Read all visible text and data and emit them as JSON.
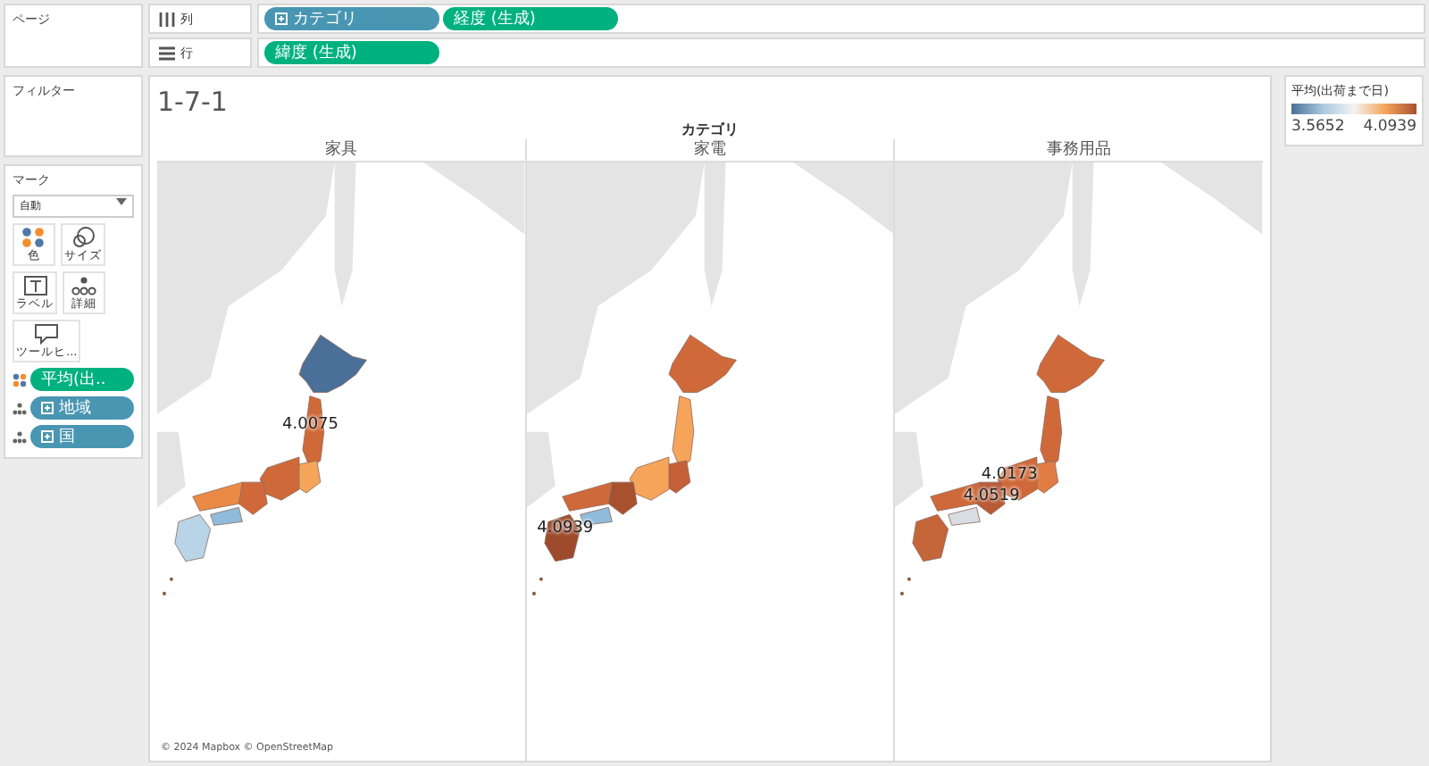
{
  "pages": {
    "title": "ページ"
  },
  "filters": {
    "title": "フィルター"
  },
  "marks": {
    "title": "マーク",
    "mark_type": "自動",
    "buttons": [
      {
        "kind": "color",
        "label": "色"
      },
      {
        "kind": "size",
        "label": "サイズ"
      },
      {
        "kind": "label",
        "label": "ラベル"
      },
      {
        "kind": "detail",
        "label": "詳細"
      },
      {
        "kind": "tooltip",
        "label": "ツールヒ..."
      }
    ],
    "pills": [
      {
        "kind": "color",
        "label": "平均(出..",
        "discrete": false
      },
      {
        "kind": "detail",
        "label": "地域",
        "discrete": true
      },
      {
        "kind": "detail",
        "label": "国",
        "discrete": true
      }
    ]
  },
  "shelves": [
    {
      "kind": "columns",
      "label": "列",
      "pills": [
        {
          "label": "カテゴリ",
          "discrete": true
        },
        {
          "label": "経度 (生成)",
          "discrete": false
        }
      ]
    },
    {
      "kind": "rows",
      "label": "行",
      "pills": [
        {
          "label": "緯度 (生成)",
          "discrete": false
        }
      ]
    }
  ],
  "view": {
    "title": "1-7-1",
    "header": "カテゴリ",
    "panels": [
      {
        "name": "家具",
        "labels": [
          "4.0075"
        ]
      },
      {
        "name": "家電",
        "labels": [
          "4.0939"
        ]
      },
      {
        "name": "事務用品",
        "labels": [
          "4.0173",
          "4.0519"
        ]
      }
    ],
    "attribution": "© 2024 Mapbox © OpenStreetMap"
  },
  "legend": {
    "title": "平均(出荷まで日)",
    "min": "3.5652",
    "max": "4.0939"
  }
}
